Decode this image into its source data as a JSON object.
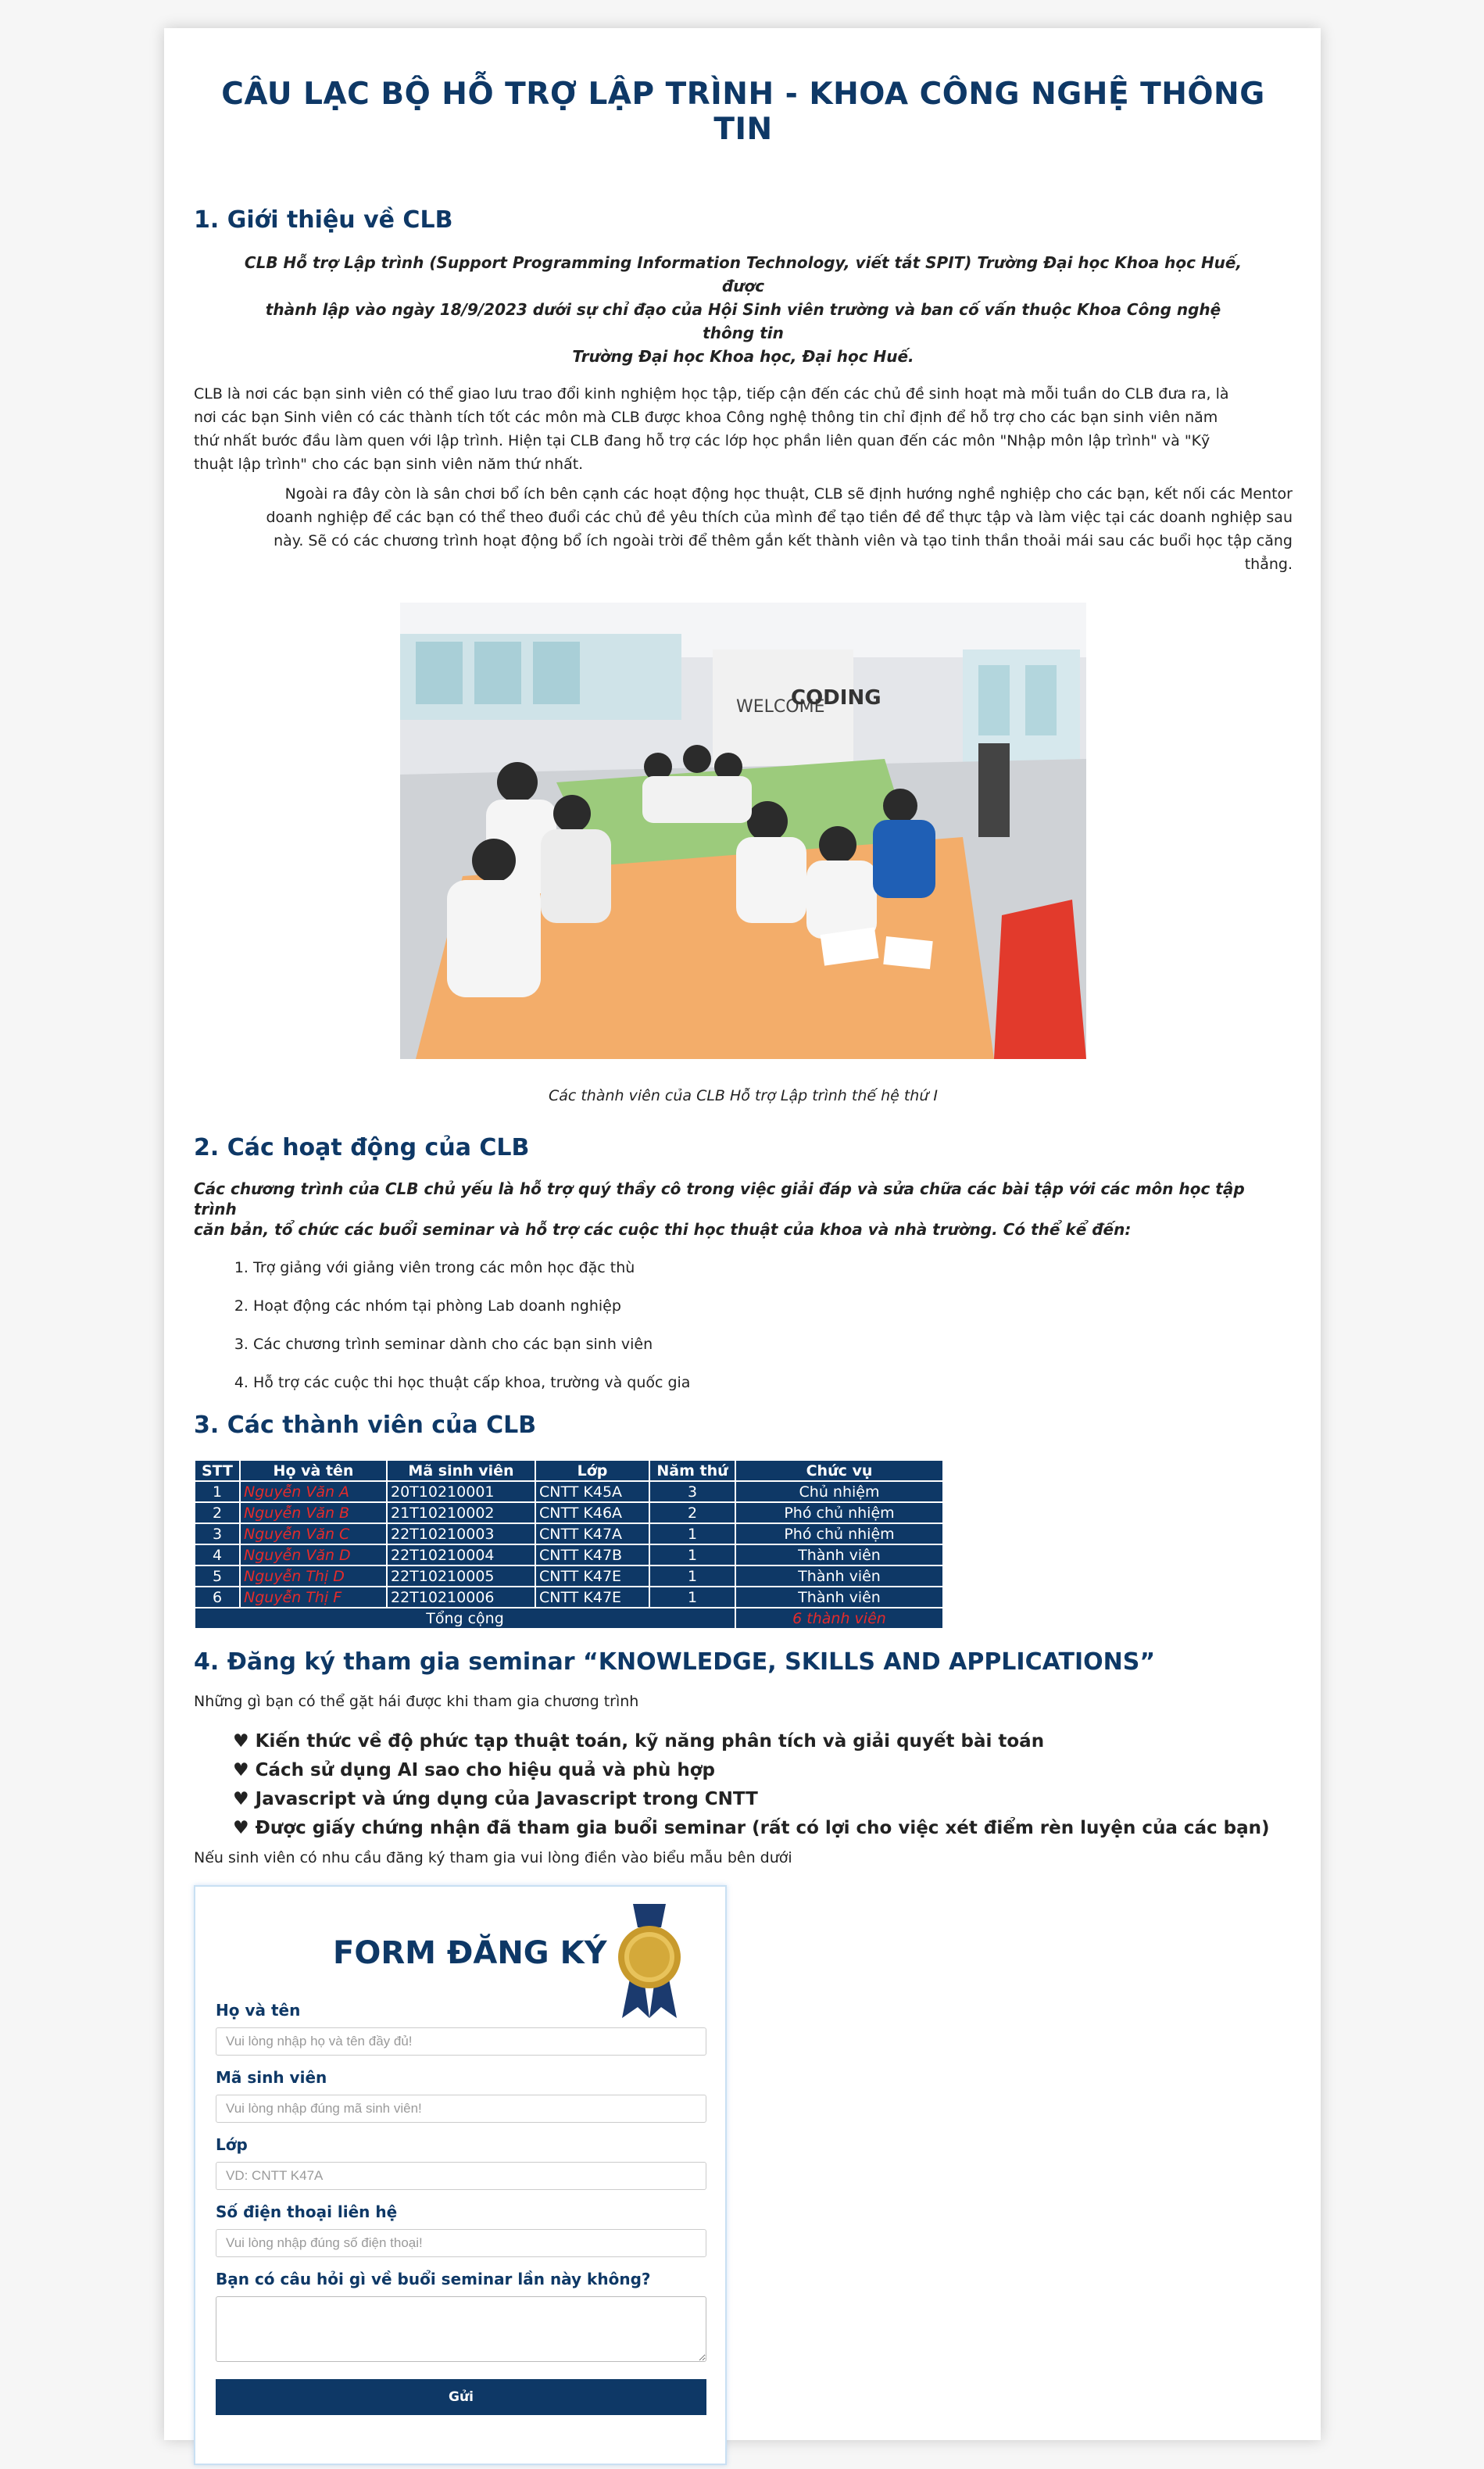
{
  "page": {
    "title": "CÂU LẠC BỘ HỖ TRỢ LẬP TRÌNH - KHOA CÔNG NGHỆ THÔNG TIN"
  },
  "intro": {
    "heading": "1. Giới thiệu về CLB",
    "bold_lines": [
      "CLB Hỗ trợ Lập trình (Support Programming Information Technology, viết tắt SPIT) Trường Đại học Khoa học Huế, được",
      "thành lập vào ngày 18/9/2023 dưới sự chỉ đạo của Hội Sinh viên trường và ban cố vấn thuộc Khoa Công nghệ thông tin",
      "Trường Đại học Khoa học, Đại học Huế."
    ],
    "para1_lines": [
      "CLB là nơi các bạn sinh viên có thể giao lưu trao đổi kinh nghiệm học tập, tiếp cận đến các chủ đề sinh hoạt mà mỗi tuần do CLB đưa ra, là",
      "nơi các bạn Sinh viên có các thành tích tốt các môn mà CLB được khoa Công nghệ thông tin chỉ định để hỗ trợ cho các bạn sinh viên năm",
      "thứ nhất bước đầu làm quen với lập trình. Hiện tại CLB đang hỗ trợ các lớp học phần liên quan đến các môn \"Nhập môn lập trình\" và \"Kỹ",
      "thuật lập trình\" cho các bạn sinh viên năm thứ nhất."
    ],
    "para2_lines": [
      "Ngoài ra đây còn là sân chơi bổ ích bên cạnh các hoạt động học thuật, CLB sẽ định hướng nghề nghiệp cho các bạn, kết nối các Mentor",
      "doanh nghiệp để các bạn có thể theo đuổi các chủ đề yêu thích của mình để tạo tiền đề để thực tập và làm việc tại các doanh nghiệp sau",
      "này. Sẽ có các chương trình hoạt động bổ ích ngoài trời để thêm gắn kết thành viên và tạo tinh thần thoải mái sau các buổi học tập căng",
      "thẳng."
    ],
    "photo_signs": [
      "WELCOME",
      "CODING"
    ],
    "caption": "Các thành viên của CLB Hỗ trợ Lập trình thế hệ thứ I"
  },
  "activities": {
    "heading": "2. Các hoạt động của CLB",
    "lead_lines": [
      "Các chương trình của CLB chủ yếu là hỗ trợ quý thầy cô trong việc giải đáp và sửa chữa các bài tập với các môn học tập trình",
      "căn bản, tổ chức các buổi seminar và hỗ trợ các cuộc thi học thuật của khoa và nhà trường. Có thể kể đến:"
    ],
    "items": [
      "Trợ giảng với giảng viên trong các môn học đặc thù",
      "Hoạt động các nhóm tại phòng Lab doanh nghiệp",
      "Các chương trình seminar dành cho các bạn sinh viên",
      "Hỗ trợ các cuộc thi học thuật cấp khoa, trường và quốc gia"
    ]
  },
  "members": {
    "heading": "3. Các thành viên của CLB",
    "columns": [
      "STT",
      "Họ và tên",
      "Mã sinh viên",
      "Lớp",
      "Năm thứ",
      "Chức vụ"
    ],
    "rows": [
      [
        "1",
        "Nguyễn Văn A",
        "20T10210001",
        "CNTT K45A",
        "3",
        "Chủ nhiệm"
      ],
      [
        "2",
        "Nguyễn Văn B",
        "21T10210002",
        "CNTT K46A",
        "2",
        "Phó chủ nhiệm"
      ],
      [
        "3",
        "Nguyễn Văn C",
        "22T10210003",
        "CNTT K47A",
        "1",
        "Phó chủ nhiệm"
      ],
      [
        "4",
        "Nguyễn Văn D",
        "22T10210004",
        "CNTT K47B",
        "1",
        "Thành viên"
      ],
      [
        "5",
        "Nguyễn Thị D",
        "22T10210005",
        "CNTT K47E",
        "1",
        "Thành viên"
      ],
      [
        "6",
        "Nguyễn Thị F",
        "22T10210006",
        "CNTT K47E",
        "1",
        "Thành viên"
      ]
    ],
    "total_label": "Tổng cộng",
    "total_value": "6 thành viên"
  },
  "seminar": {
    "heading": "4. Đăng ký tham gia seminar “KNOWLEDGE, SKILLS AND APPLICATIONS”",
    "intro": "Những gì bạn có thể gặt hái được khi tham gia chương trình",
    "benefits": [
      "Kiến thức về độ phức tạp thuật toán, kỹ năng phân tích và giải quyết bài toán",
      "Cách sử dụng AI sao cho hiệu quả và phù hợp",
      "Javascript và ứng dụng của Javascript trong CNTT",
      "Được giấy chứng nhận đã tham gia buổi seminar (rất có lợi cho việc xét điểm rèn luyện của các bạn)"
    ],
    "form_prompt": "Nếu sinh viên có nhu cầu đăng ký tham gia vui lòng điền vào biểu mẫu bên dưới"
  },
  "form": {
    "title": "FORM ĐĂNG KÝ",
    "fields": [
      {
        "label": "Họ và tên",
        "placeholder": "Vui lòng nhập họ và tên đầy đủ!"
      },
      {
        "label": "Mã sinh viên",
        "placeholder": "Vui lòng nhập đúng mã sinh viên!"
      },
      {
        "label": "Lớp",
        "placeholder": "VD: CNTT K47A"
      },
      {
        "label": "Số điện thoại liên hệ",
        "placeholder": "Vui lòng nhập đúng số điện thoại!"
      }
    ],
    "question_label": "Bạn có câu hỏi gì về buổi seminar lần này không?",
    "submit_label": "Gửi"
  },
  "colors": {
    "primary": "#0e3866",
    "accent_red": "#e52b2b",
    "photo_table": "#f3ad6a",
    "photo_green": "#9ccb7c"
  }
}
